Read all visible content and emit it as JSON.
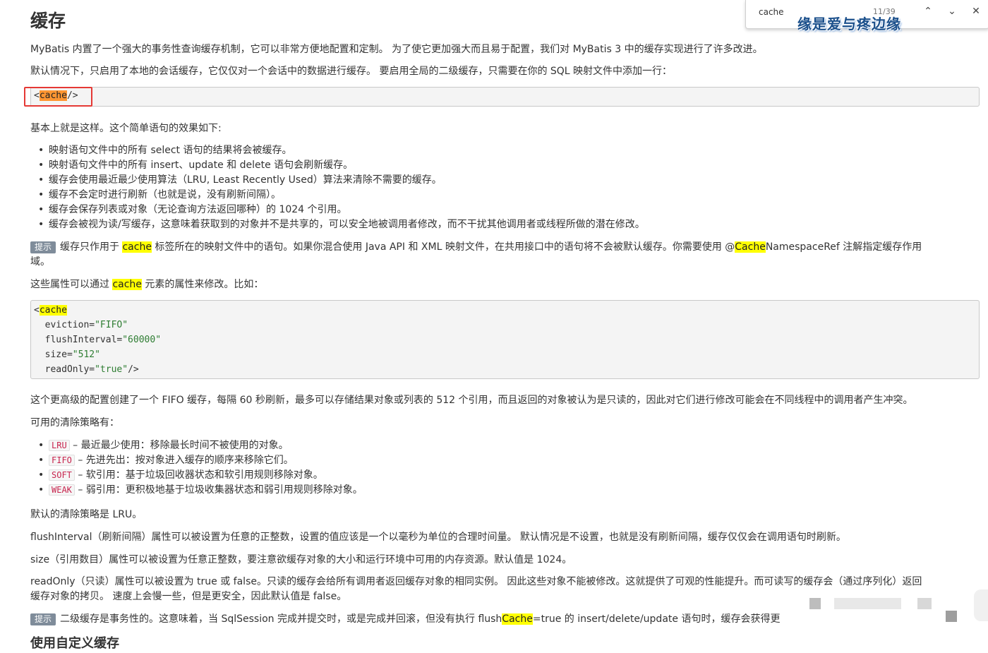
{
  "title": "缓存",
  "intro": {
    "p1": "MyBatis 内置了一个强大的事务性查询缓存机制，它可以非常方便地配置和定制。 为了使它更加强大而且易于配置，我们对 MyBatis 3 中的缓存实现进行了许多改进。",
    "p2": "默认情况下，只启用了本地的会话缓存，它仅仅对一个会话中的数据进行缓存。 要启用全局的二级缓存，只需要在你的 SQL 映射文件中添加一行："
  },
  "code1": {
    "lt": "<",
    "tag": "cache",
    "end": "/>"
  },
  "basic": "基本上就是这样。这个简单语句的效果如下:",
  "effects": [
    "映射语句文件中的所有 select 语句的结果将会被缓存。",
    "映射语句文件中的所有 insert、update 和 delete 语句会刷新缓存。",
    "缓存会使用最近最少使用算法（LRU, Least Recently Used）算法来清除不需要的缓存。",
    "缓存不会定时进行刷新（也就是说，没有刷新间隔）。",
    "缓存会保存列表或对象（无论查询方法返回哪种）的 1024 个引用。",
    "缓存会被视为读/写缓存，这意味着获取到的对象并不是共享的，可以安全地被调用者修改，而不干扰其他调用者或线程所做的潜在修改。"
  ],
  "tip_label": "提示",
  "tip1": {
    "a": "缓存只作用于 ",
    "hl": "cache",
    "b": " 标签所在的映射文件中的语句。如果你混合使用 Java API 和 XML 映射文件，在共用接口中的语句将不会被默认缓存。你需要使用 @",
    "hl2": "Cache",
    "c": "NamespaceRef 注解指定缓存作用",
    "line2": "域。"
  },
  "modify": {
    "a": "这些属性可以通过 ",
    "hl": "cache",
    "b": " 元素的属性来修改。比如："
  },
  "code2": {
    "lt": "<",
    "tag": "cache",
    "lines": [
      {
        "attr": "  eviction=",
        "val": "\"FIFO\"",
        "end": ""
      },
      {
        "attr": "  flushInterval=",
        "val": "\"60000\"",
        "end": ""
      },
      {
        "attr": "  size=",
        "val": "\"512\"",
        "end": ""
      },
      {
        "attr": "  readOnly=",
        "val": "\"true\"",
        "end": "/>"
      }
    ]
  },
  "advanced": "这个更高级的配置创建了一个 FIFO 缓存，每隔 60 秒刷新，最多可以存储结果对象或列表的 512 个引用，而且返回的对象被认为是只读的，因此对它们进行修改可能会在不同线程中的调用者产生冲突。",
  "policies_title": "可用的清除策略有：",
  "policies": [
    {
      "code": "LRU",
      "text": " – 最近最少使用：移除最长时间不被使用的对象。"
    },
    {
      "code": "FIFO",
      "text": " – 先进先出：按对象进入缓存的顺序来移除它们。"
    },
    {
      "code": "SOFT",
      "text": " – 软引用：基于垃圾回收器状态和软引用规则移除对象。"
    },
    {
      "code": "WEAK",
      "text": " – 弱引用：更积极地基于垃圾收集器状态和弱引用规则移除对象。"
    }
  ],
  "default_policy": "默认的清除策略是 LRU。",
  "flush": "flushInterval（刷新间隔）属性可以被设置为任意的正整数，设置的值应该是一个以毫秒为单位的合理时间量。 默认情况是不设置，也就是没有刷新间隔，缓存仅仅会在调用语句时刷新。",
  "size": "size（引用数目）属性可以被设置为任意正整数，要注意欲缓存对象的大小和运行环境中可用的内存资源。默认值是 1024。",
  "readonly": {
    "l1": "readOnly（只读）属性可以被设置为 true 或 false。只读的缓存会给所有调用者返回缓存对象的相同实例。 因此这些对象不能被修改。这就提供了可观的性能提升。而可读写的缓存会（通过序列化）返回",
    "l2": "缓存对象的拷贝。 速度上会慢一些，但是更安全，因此默认值是 false。"
  },
  "tip2": {
    "a": "二级缓存是事务性的。这意味着，当 SqlSession 完成并提交时，或是完成并回滚，但没有执行 flush",
    "hl": "Cache",
    "b": "=true 的 insert/delete/update 语句时，缓存会获得更"
  },
  "subheading": "使用自定义缓存",
  "findbar": {
    "query": "cache",
    "count": "11/39",
    "prev": "⌃",
    "next": "⌄",
    "close": "✕"
  },
  "watermark_brand": "缘是爱与疼边缘",
  "colors": {
    "highlight": "#ffff00",
    "current_match": "#ff9632",
    "red_box": "#e53935",
    "string": "#2e7d32"
  }
}
